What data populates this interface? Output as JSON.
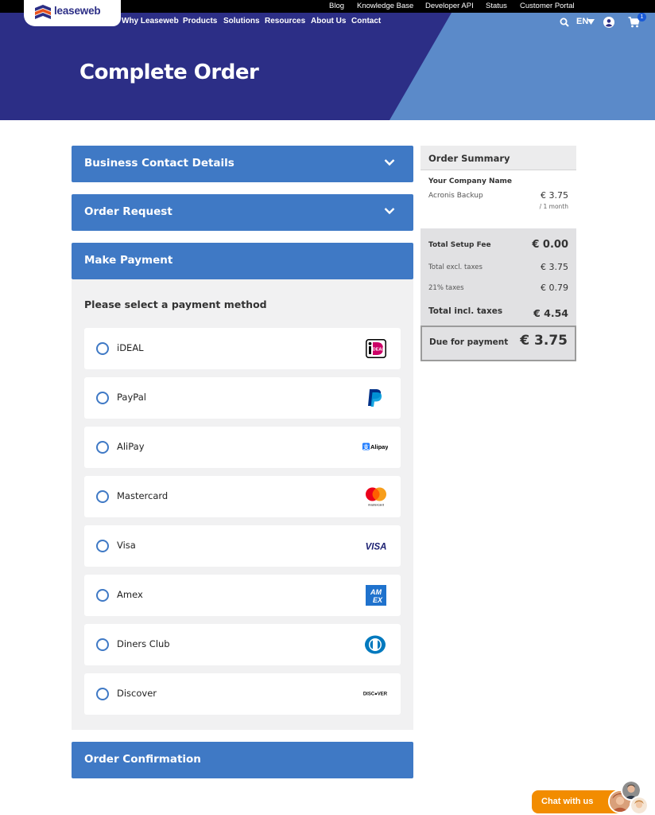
{
  "header": {
    "top_links": [
      "Blog",
      "Knowledge Base",
      "Developer API",
      "Status",
      "Customer Portal"
    ],
    "logo_text": "leaseweb",
    "nav": [
      "Why Leaseweb",
      "Products",
      "Solutions",
      "Resources",
      "About Us",
      "Contact"
    ],
    "language": "EN",
    "cart_count": "1",
    "page_title": "Complete Order"
  },
  "sections": {
    "business_contact": "Business Contact Details",
    "order_request": "Order Request",
    "make_payment": "Make Payment",
    "order_confirmation": "Order Confirmation"
  },
  "payment": {
    "heading": "Please select a payment method",
    "methods": [
      {
        "label": "iDEAL",
        "icon": "ideal-logo-icon"
      },
      {
        "label": "PayPal",
        "icon": "paypal-logo-icon"
      },
      {
        "label": "AliPay",
        "icon": "alipay-logo-icon"
      },
      {
        "label": "Mastercard",
        "icon": "mastercard-logo-icon"
      },
      {
        "label": "Visa",
        "icon": "visa-logo-icon"
      },
      {
        "label": "Amex",
        "icon": "amex-logo-icon"
      },
      {
        "label": "Diners Club",
        "icon": "diners-club-logo-icon"
      },
      {
        "label": "Discover",
        "icon": "discover-logo-icon"
      }
    ],
    "logo_texts": {
      "ideal": "iDEAL",
      "alipay": "Alipay",
      "mastercard": "mastercard",
      "visa": "VISA",
      "amex_top": "AM",
      "amex_bottom": "EX",
      "discover": "DISC●VER"
    }
  },
  "summary": {
    "title": "Order Summary",
    "company": "Your Company Name",
    "product": "Acronis Backup",
    "product_price": "€ 3.75",
    "product_period": "/ 1 month",
    "setup_fee_label": "Total Setup Fee",
    "setup_fee": "€ 0.00",
    "excl_label": "Total excl. taxes",
    "excl": "€ 3.75",
    "tax_label": "21% taxes",
    "tax": "€ 0.79",
    "incl_label": "Total incl. taxes",
    "incl": "€ 4.54",
    "due_label": "Due for payment",
    "due": "€ 3.75"
  },
  "chat": {
    "label": "Chat with us"
  },
  "colors": {
    "hero_dark": "#2c2e86",
    "hero_light": "#5b8ac9",
    "accent": "#3f79c5",
    "chat": "#f28c00"
  }
}
